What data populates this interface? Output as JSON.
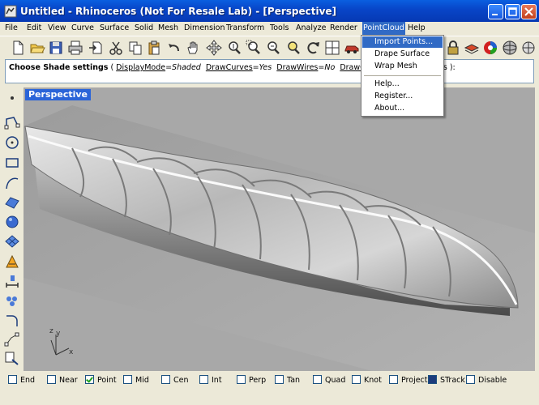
{
  "window": {
    "title": "Untitled - Rhinoceros (Not For Resale Lab) - [Perspective]",
    "title_bar_color": "#0845c8"
  },
  "menubar": {
    "items": [
      "File",
      "Edit",
      "View",
      "Curve",
      "Surface",
      "Solid",
      "Mesh",
      "Dimension",
      "Transform",
      "Tools",
      "Analyze",
      "Render",
      "PointCloud",
      "Help"
    ],
    "active": "PointCloud"
  },
  "dropdown": {
    "items": [
      "Import Points...",
      "Drape Surface",
      "Wrap Mesh",
      "Help...",
      "Register...",
      "About..."
    ],
    "highlighted": "Import Points..."
  },
  "command": {
    "prompt": "Choose Shade settings",
    "open_paren": " ( ",
    "opt1_name": "DisplayMode",
    "opt1_value": "Shaded",
    "opt2_name": "DrawCurves",
    "opt2_value": "Yes",
    "opt3_name": "DrawWires",
    "opt3_value": "No",
    "opt4_partial": "DrawG",
    "tail": "es ):"
  },
  "viewport": {
    "label": "Perspective",
    "axis_z": "z",
    "axis_y": "y",
    "axis_x": "x",
    "background_color": "#a8a8a8"
  },
  "toolbar": {
    "icons": [
      "new-icon",
      "open-icon",
      "save-icon",
      "print-icon",
      "import-icon",
      "cut-icon",
      "copy-icon",
      "paste-icon",
      "undo-icon",
      "pan-icon",
      "move-view-icon",
      "zoom-dynamic-icon",
      "zoom-window-icon",
      "zoom-extents-icon",
      "rotate-view-icon",
      "four-viewports-icon",
      "car-icon"
    ]
  },
  "osnap": [
    {
      "label": "End",
      "checked": false
    },
    {
      "label": "Near",
      "checked": false
    },
    {
      "label": "Point",
      "checked": true
    },
    {
      "label": "Mid",
      "checked": false
    },
    {
      "label": "Cen",
      "checked": false
    },
    {
      "label": "Int",
      "checked": false
    },
    {
      "label": "Perp",
      "checked": false
    },
    {
      "label": "Tan",
      "checked": false
    },
    {
      "label": "Quad",
      "checked": false
    },
    {
      "label": "Knot",
      "checked": false
    },
    {
      "label": "Project",
      "checked": false
    },
    {
      "label": "STrack",
      "checked": true
    },
    {
      "label": "Disable",
      "checked": false
    }
  ]
}
